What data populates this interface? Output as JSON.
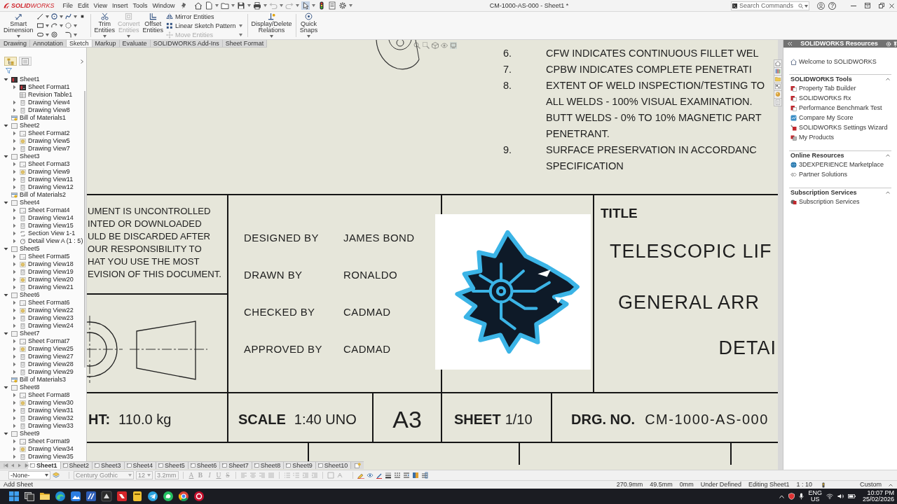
{
  "app": {
    "logo": "**SOLID**WORKS",
    "menus": [
      "File",
      "Edit",
      "View",
      "Insert",
      "Tools",
      "Window"
    ],
    "document_title": "CM-1000-AS-000 - Sheet1 *",
    "search": {
      "placeholder": "Search Commands"
    },
    "help_label": "?"
  },
  "command_manager": {
    "groups": [
      {
        "kind": "large",
        "label": "Smart Dimension",
        "disabled": false
      },
      {
        "kind": "sketch-grid"
      },
      {
        "kind": "large",
        "label": "Trim Entities",
        "disabled": false
      },
      {
        "kind": "large",
        "label": "Convert Entities",
        "disabled": true
      },
      {
        "kind": "large",
        "label": "Offset Entities",
        "disabled": false
      },
      {
        "kind": "list",
        "items": [
          {
            "label": "Mirror Entities",
            "disabled": false
          },
          {
            "label": "Linear Sketch Pattern",
            "disabled": false
          },
          {
            "label": "Move Entities",
            "disabled": true
          }
        ]
      },
      {
        "kind": "large",
        "label": "Display/Delete Relations",
        "disabled": false
      },
      {
        "kind": "large",
        "label": "Quick Snaps",
        "disabled": false
      }
    ]
  },
  "tabs": [
    {
      "label": "Drawing",
      "selected": false
    },
    {
      "label": "Annotation",
      "selected": false
    },
    {
      "label": "Sketch",
      "selected": true
    },
    {
      "label": "Markup",
      "selected": false
    },
    {
      "label": "Evaluate",
      "selected": false
    },
    {
      "label": "SOLIDWORKS Add-Ins",
      "selected": false
    },
    {
      "label": "Sheet Format",
      "selected": false
    }
  ],
  "feature_tree": {
    "tabs": [
      {
        "selected": true
      },
      {
        "selected": false
      }
    ],
    "items": [
      {
        "label": "Sheet1",
        "kind": "active-sheet",
        "expanded": true,
        "children": [
          {
            "label": "Sheet Format1",
            "kind": "active-format",
            "expanded": false
          },
          {
            "label": "Revision Table1",
            "kind": "table"
          },
          {
            "label": "Drawing View4",
            "kind": "view",
            "expanded": false
          },
          {
            "label": "Drawing View8",
            "kind": "view",
            "expanded": false
          }
        ]
      },
      {
        "label": "Bill of Materials1",
        "kind": "bom"
      },
      {
        "label": "Sheet2",
        "kind": "sheet",
        "expanded": true,
        "children": [
          {
            "label": "Sheet Format2",
            "kind": "format",
            "expanded": false
          },
          {
            "label": "Drawing View5",
            "kind": "model-view",
            "expanded": false
          },
          {
            "label": "Drawing View7",
            "kind": "view",
            "expanded": false
          }
        ]
      },
      {
        "label": "Sheet3",
        "kind": "sheet",
        "expanded": true,
        "children": [
          {
            "label": "Sheet Format3",
            "kind": "format",
            "expanded": false
          },
          {
            "label": "Drawing View9",
            "kind": "model-view",
            "expanded": false
          },
          {
            "label": "Drawing View11",
            "kind": "view",
            "expanded": false
          },
          {
            "label": "Drawing View12",
            "kind": "view",
            "expanded": false
          }
        ]
      },
      {
        "label": "Bill of Materials2",
        "kind": "bom"
      },
      {
        "label": "Sheet4",
        "kind": "sheet",
        "expanded": true,
        "children": [
          {
            "label": "Sheet Format4",
            "kind": "format",
            "expanded": false
          },
          {
            "label": "Drawing View14",
            "kind": "view",
            "expanded": false
          },
          {
            "label": "Drawing View15",
            "kind": "view",
            "expanded": false
          },
          {
            "label": "Section View 1-1",
            "kind": "section",
            "expanded": false
          },
          {
            "label": "Detail View A (1 : 5)",
            "kind": "detail",
            "expanded": false
          }
        ]
      },
      {
        "label": "Sheet5",
        "kind": "sheet",
        "expanded": true,
        "children": [
          {
            "label": "Sheet Format5",
            "kind": "format",
            "expanded": false
          },
          {
            "label": "Drawing View18",
            "kind": "model-view",
            "expanded": false
          },
          {
            "label": "Drawing View19",
            "kind": "view",
            "expanded": false
          },
          {
            "label": "Drawing View20",
            "kind": "model-view",
            "expanded": false
          },
          {
            "label": "Drawing View21",
            "kind": "view",
            "expanded": false
          }
        ]
      },
      {
        "label": "Sheet6",
        "kind": "sheet",
        "expanded": true,
        "children": [
          {
            "label": "Sheet Format6",
            "kind": "format",
            "expanded": false
          },
          {
            "label": "Drawing View22",
            "kind": "model-view",
            "expanded": false
          },
          {
            "label": "Drawing View23",
            "kind": "view",
            "expanded": false
          },
          {
            "label": "Drawing View24",
            "kind": "view",
            "expanded": false
          }
        ]
      },
      {
        "label": "Sheet7",
        "kind": "sheet",
        "expanded": true,
        "children": [
          {
            "label": "Sheet Format7",
            "kind": "format",
            "expanded": false
          },
          {
            "label": "Drawing View25",
            "kind": "model-view",
            "expanded": false
          },
          {
            "label": "Drawing View27",
            "kind": "view",
            "expanded": false
          },
          {
            "label": "Drawing View28",
            "kind": "view",
            "expanded": false
          },
          {
            "label": "Drawing View29",
            "kind": "view",
            "expanded": false
          }
        ]
      },
      {
        "label": "Bill of Materials3",
        "kind": "bom"
      },
      {
        "label": "Sheet8",
        "kind": "sheet",
        "expanded": true,
        "children": [
          {
            "label": "Sheet Format8",
            "kind": "format",
            "expanded": false
          },
          {
            "label": "Drawing View30",
            "kind": "model-view",
            "expanded": false
          },
          {
            "label": "Drawing View31",
            "kind": "view",
            "expanded": false
          },
          {
            "label": "Drawing View32",
            "kind": "view",
            "expanded": false
          },
          {
            "label": "Drawing View33",
            "kind": "view",
            "expanded": false
          }
        ]
      },
      {
        "label": "Sheet9",
        "kind": "sheet",
        "expanded": true,
        "children": [
          {
            "label": "Sheet Format9",
            "kind": "format",
            "expanded": false
          },
          {
            "label": "Drawing View34",
            "kind": "model-view",
            "expanded": false
          },
          {
            "label": "Drawing View35",
            "kind": "view",
            "expanded": false
          }
        ]
      }
    ]
  },
  "drawing": {
    "notes": [
      {
        "number": "6.",
        "lines": [
          "CFW INDICATES CONTINUOUS FILLET WEL"
        ]
      },
      {
        "number": "7.",
        "lines": [
          "CPBW INDICATES COMPLETE PENETRATI"
        ]
      },
      {
        "number": "8.",
        "lines": [
          "EXTENT OF WELD INSPECTION/TESTING TO",
          "ALL WELDS - 100% VISUAL EXAMINATION.",
          "BUTT WELDS - 0% TO 10% MAGNETIC PART",
          "PENETRANT."
        ]
      },
      {
        "number": "9.",
        "lines": [
          "SURFACE PRESERVATION IN ACCORDANC",
          "SPECIFICATION"
        ]
      }
    ],
    "title_block": {
      "disclaimer": [
        "UMENT IS UNCONTROLLED",
        "INTED OR DOWNLOADED",
        "ULD BE DISCARDED AFTER",
        "OUR RESPONSIBILITY TO",
        "HAT YOU USE THE MOST",
        "EVISION OF THIS DOCUMENT."
      ],
      "approvals": [
        {
          "role": "DESIGNED BY",
          "name": "JAMES BOND"
        },
        {
          "role": "DRAWN BY",
          "name": "RONALDO"
        },
        {
          "role": "CHECKED BY",
          "name": "CADMAD"
        },
        {
          "role": "APPROVED BY",
          "name": "CADMAD"
        }
      ],
      "title_label": "TITLE",
      "title_lines": [
        "TELESCOPIC LIF",
        "GENERAL ARR",
        "DETAI"
      ],
      "weight": {
        "label": "HT:",
        "value": "110.0 kg"
      },
      "scale": {
        "label": "SCALE",
        "value": "1:40 UNO"
      },
      "size": "A3",
      "sheet": {
        "label": "SHEET",
        "value": "1/10"
      },
      "drawing_number": {
        "label": "DRG. NO.",
        "value": "CM-1000-AS-000"
      }
    }
  },
  "task_pane": {
    "title": "SOLIDWORKS Resources",
    "welcome": "Welcome to SOLIDWORKS",
    "sections": [
      {
        "title": "SOLIDWORKS Tools",
        "expanded": true,
        "items": [
          {
            "label": "Property Tab Builder",
            "kind": "tool"
          },
          {
            "label": "SOLIDWORKS Rx",
            "kind": "tool"
          },
          {
            "label": "Performance Benchmark Test",
            "kind": "tool"
          },
          {
            "label": "Compare My Score",
            "kind": "score"
          },
          {
            "label": "SOLIDWORKS Settings Wizard",
            "kind": "wizard"
          },
          {
            "label": "My Products",
            "kind": "products"
          }
        ]
      },
      {
        "title": "Online Resources",
        "expanded": true,
        "items": [
          {
            "label": "3DEXPERIENCE Marketplace",
            "kind": "marketplace"
          },
          {
            "label": "Partner Solutions",
            "kind": "partners"
          }
        ]
      },
      {
        "title": "Subscription Services",
        "expanded": true,
        "items": [
          {
            "label": "Subscription Services",
            "kind": "subscription"
          }
        ]
      }
    ]
  },
  "sheet_tabs": [
    {
      "label": "Sheet1",
      "selected": true
    },
    {
      "label": "Sheet2",
      "selected": false
    },
    {
      "label": "Sheet3",
      "selected": false
    },
    {
      "label": "Sheet4",
      "selected": false
    },
    {
      "label": "Sheet5",
      "selected": false
    },
    {
      "label": "Sheet6",
      "selected": false
    },
    {
      "label": "Sheet7",
      "selected": false
    },
    {
      "label": "Sheet8",
      "selected": false
    },
    {
      "label": "Sheet9",
      "selected": false
    },
    {
      "label": "Sheet10",
      "selected": false
    }
  ],
  "format_bar": {
    "fields": [
      {
        "kind": "dropdown",
        "value": "-None-",
        "disabled": false
      },
      {
        "kind": "dropdown",
        "value": "Century Gothic",
        "disabled": true
      },
      {
        "kind": "dropdown",
        "value": "12",
        "disabled": true
      },
      {
        "kind": "input",
        "value": "3.2mm",
        "disabled": true
      }
    ],
    "styles": [
      {
        "label": "A",
        "disabled": true
      },
      {
        "label": "B",
        "disabled": true
      },
      {
        "label": "I",
        "disabled": true
      },
      {
        "label": "U",
        "disabled": true
      },
      {
        "label": "S",
        "disabled": true
      }
    ]
  },
  "status_bar": {
    "message": "Add Sheet",
    "fields": [
      "270.9mm",
      "49.5mm",
      "0mm",
      "Under Defined",
      "Editing Sheet1",
      "1 : 10"
    ],
    "units": "Custom"
  },
  "taskbar": {
    "language": "ENG",
    "region": "US",
    "time": "10:07 PM",
    "date": "25/02/2026"
  }
}
